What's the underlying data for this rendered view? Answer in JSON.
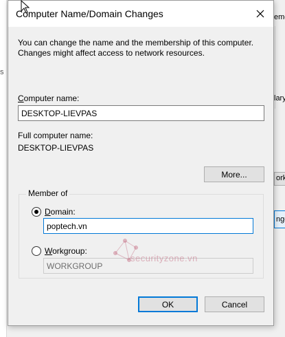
{
  "background": {
    "right_fragments": [
      "emo",
      "",
      "lary",
      "ork",
      "nge"
    ],
    "left_fragment": "s"
  },
  "dialog": {
    "title": "Computer Name/Domain Changes",
    "description": "You can change the name and the membership of this computer. Changes might affect access to network resources.",
    "computer_name_label": "Computer name:",
    "computer_name_value": "DESKTOP-LIEVPAS",
    "full_name_label": "Full computer name:",
    "full_name_value": "DESKTOP-LIEVPAS",
    "more_button": "More...",
    "member_of_label": "Member of",
    "domain_label": "Domain:",
    "domain_value": "poptech.vn",
    "workgroup_label": "Workgroup:",
    "workgroup_value": "WORKGROUP",
    "ok_button": "OK",
    "cancel_button": "Cancel",
    "selected_membership": "domain"
  },
  "watermark": {
    "text": "securityzone.vn"
  },
  "colors": {
    "accent": "#0078d7",
    "dialog_bg": "#f0f0f0",
    "button_bg": "#e1e1e1"
  }
}
